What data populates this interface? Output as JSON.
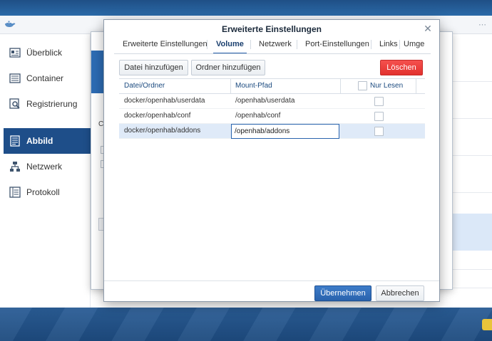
{
  "app": {
    "nav": [
      {
        "label": "Überblick",
        "icon": "overview-icon"
      },
      {
        "label": "Container",
        "icon": "container-icon"
      },
      {
        "label": "Registrierung",
        "icon": "registry-icon"
      },
      {
        "label": "Abbild",
        "icon": "image-icon"
      },
      {
        "label": "Netzwerk",
        "icon": "network-icon"
      },
      {
        "label": "Protokoll",
        "icon": "log-icon"
      }
    ],
    "active_nav": "Abbild"
  },
  "background_dialog": {
    "truncated_label": "C"
  },
  "dialog": {
    "title": "Erweiterte Einstellungen",
    "tabs": [
      "Erweiterte Einstellungen",
      "Volume",
      "Netzwerk",
      "Port-Einstellungen",
      "Links",
      "Umge"
    ],
    "active_tab": "Volume",
    "toolbar": {
      "add_file": "Datei hinzufügen",
      "add_folder": "Ordner hinzufügen",
      "delete": "Löschen"
    },
    "columns": {
      "file_folder": "Datei/Ordner",
      "mount_path": "Mount-Pfad",
      "read_only": "Nur Lesen"
    },
    "rows": [
      {
        "file_folder": "docker/openhab/userdata",
        "mount_path": "/openhab/userdata",
        "read_only": false
      },
      {
        "file_folder": "docker/openhab/conf",
        "mount_path": "/openhab/conf",
        "read_only": false
      },
      {
        "file_folder": "docker/openhab/addons",
        "mount_path": "/openhab/addons",
        "read_only": false,
        "selected": true,
        "editing": true
      }
    ],
    "footer": {
      "apply": "Übernehmen",
      "cancel": "Abbrechen"
    }
  },
  "colors": {
    "accent": "#2a63ad",
    "active_nav": "#1e4e89",
    "danger": "#e2312e",
    "selected_row": "#dfeaf8"
  }
}
